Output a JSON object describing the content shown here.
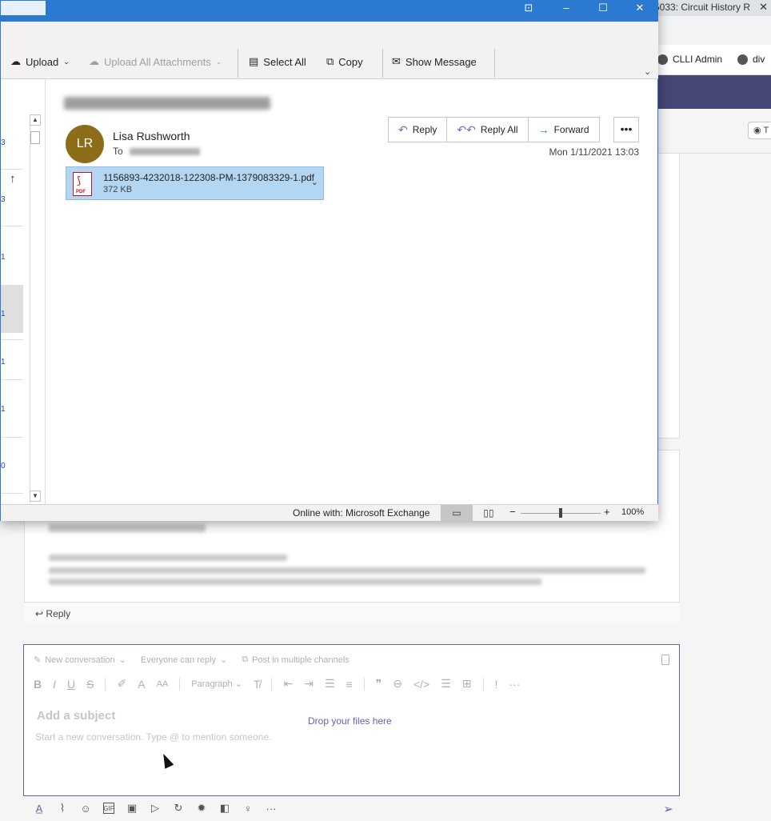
{
  "browser": {
    "tab_title": "5033: Circuit History R",
    "bookmarks": [
      "CLLI Admin",
      "div"
    ]
  },
  "teams": {
    "reply_label": "Reply",
    "compose": {
      "new_conversation": "New conversation",
      "everyone_can_reply": "Everyone can reply",
      "post_multiple": "Post in multiple channels",
      "paragraph": "Paragraph",
      "subject_placeholder": "Add a subject",
      "drop_files": "Drop your files here",
      "message_placeholder": "Start a new conversation. Type @ to mention someone."
    }
  },
  "outlook": {
    "ribbon": {
      "upload": "Upload",
      "upload_all": "Upload All Attachments",
      "select_all": "Select All",
      "copy": "Copy",
      "show_message": "Show Message"
    },
    "message": {
      "avatar_initials": "LR",
      "sender": "Lisa Rushworth",
      "to_label": "To",
      "date": "Mon 1/11/2021 13:03",
      "reply": "Reply",
      "reply_all": "Reply All",
      "forward": "Forward",
      "attachment": {
        "name": "1156893-4232018-122308-PM-1379083329-1.pdf",
        "size": "372 KB",
        "type_label": "PDF"
      }
    },
    "status": {
      "connection": "Online with: Microsoft Exchange",
      "zoom": "100%",
      "zoom_fraction": 0.5
    },
    "left_pane_numbers": [
      "3",
      "3",
      "1",
      "1",
      "1",
      "1",
      "0"
    ]
  },
  "colors": {
    "titlebar": "#2b79d0",
    "teams_brand": "#464775",
    "avatar": "#8d6c1a",
    "attachment_bg": "#b3d6f2"
  }
}
